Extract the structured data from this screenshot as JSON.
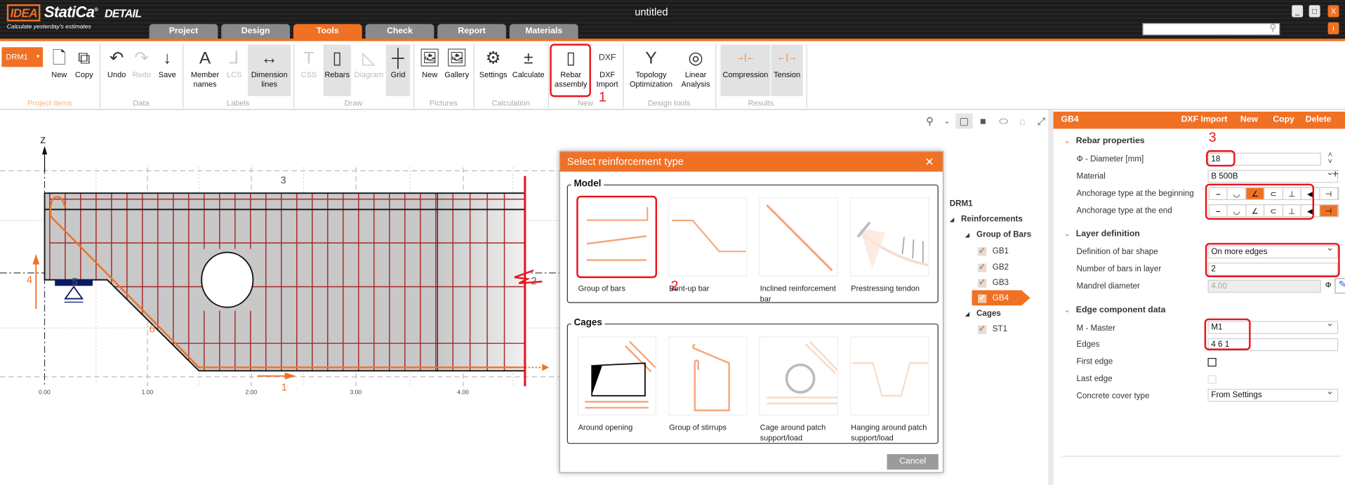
{
  "app": {
    "logo": "IDEA StatiCa",
    "product": "DETAIL",
    "slogan": "Calculate yesterday's estimates",
    "title": "untitled",
    "info_label": "i",
    "minimize": "_",
    "maximize": "□",
    "close": "X"
  },
  "tabs": [
    {
      "label": "Project"
    },
    {
      "label": "Design"
    },
    {
      "label": "Tools",
      "active": true
    },
    {
      "label": "Check"
    },
    {
      "label": "Report"
    },
    {
      "label": "Materials"
    }
  ],
  "ribbon": {
    "member_select": "DRM1",
    "buttons": {
      "new": "New",
      "copy": "Copy",
      "undo": "Undo",
      "redo": "Redo",
      "save": "Save",
      "member_names": "Member names",
      "lcs": "LCS",
      "dimension_lines": "Dimension lines",
      "css": "CSS",
      "rebars": "Rebars",
      "diagram": "Diagram",
      "grid": "Grid",
      "pic_new": "New",
      "gallery": "Gallery",
      "settings": "Settings",
      "calculate": "Calculate",
      "rebar_assembly": "Rebar assembly",
      "dxf_import": "DXF Import",
      "topology": "Topology Optimization",
      "linear": "Linear Analysis",
      "compression": "Compression",
      "tension": "Tension"
    },
    "groups": {
      "project_items": "Project items",
      "data": "Data",
      "labels": "Labels",
      "draw": "Draw",
      "pictures": "Pictures",
      "calculation": "Calculation",
      "new": "New",
      "design_tools": "Design tools",
      "results": "Results"
    }
  },
  "annotations": {
    "step1": "1",
    "step2": "2",
    "step3": "3"
  },
  "drawing": {
    "axis_z": "Z",
    "edge_labels": [
      "1",
      "2",
      "3",
      "4",
      "5",
      "6"
    ],
    "x_ticks": [
      "0.00",
      "1.00",
      "2.00",
      "3.00",
      "4.00"
    ],
    "accent": "#f07124",
    "rebar_color": "#a52a2a"
  },
  "tree": {
    "root": "DRM1",
    "reinforcements": "Reinforcements",
    "group_of_bars": "Group of Bars",
    "items": [
      "GB1",
      "GB2",
      "GB3",
      "GB4"
    ],
    "selected": "GB4",
    "cages": "Cages",
    "cage_items": [
      "ST1"
    ]
  },
  "dialog": {
    "title": "Select reinforcement type",
    "model_title": "Model",
    "model_items": [
      "Group of bars",
      "Bent-up bar",
      "Inclined reinforcement bar",
      "Prestressing tendon"
    ],
    "cages_title": "Cages",
    "cage_items": [
      "Around opening",
      "Group of stirrups",
      "Cage around patch support/load",
      "Hanging around patch support/load"
    ],
    "cancel": "Cancel"
  },
  "panel": {
    "name": "GB4",
    "actions": [
      "DXF Import",
      "New",
      "Copy",
      "Delete"
    ],
    "rebar_properties": {
      "title": "Rebar properties",
      "diameter_label": "Φ - Diameter [mm]",
      "diameter": "18",
      "material_label": "Material",
      "material": "B 500B",
      "anchor_begin_label": "Anchorage type at the beginning",
      "anchor_end_label": "Anchorage type at the end",
      "anchor_types": [
        "straight",
        "bend 90",
        "bend 135",
        "hook 180",
        "welded bar",
        "anchor plate",
        "coupler"
      ],
      "anchor_begin_selected": 2,
      "anchor_end_selected": 6
    },
    "layer": {
      "title": "Layer definition",
      "shape_label": "Definition of bar shape",
      "shape": "On more edges",
      "count_label": "Number of bars in layer",
      "count": "2",
      "mandrel_label": "Mandrel diameter",
      "mandrel": "4.00",
      "phi": "Φ"
    },
    "edge": {
      "title": "Edge component data",
      "master_label": "M - Master",
      "master": "M1",
      "edges_label": "Edges",
      "edges": "4 6 1",
      "first_label": "First edge",
      "first": false,
      "last_label": "Last edge",
      "last": false,
      "cover_label": "Concrete cover type",
      "cover": "From Settings"
    }
  }
}
